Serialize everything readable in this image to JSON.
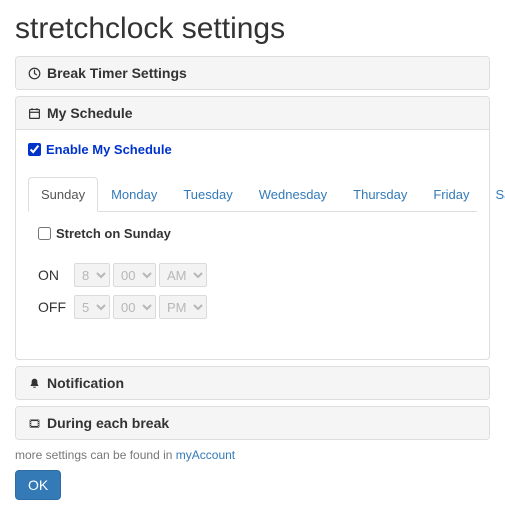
{
  "title": "stretchclock settings",
  "sections": {
    "breakTimer": "Break Timer Settings",
    "mySchedule": "My Schedule",
    "notification": "Notification",
    "duringBreak": "During each break"
  },
  "enable": {
    "label": "Enable My Schedule",
    "checked": true
  },
  "tabs": [
    "Sunday",
    "Monday",
    "Tuesday",
    "Wednesday",
    "Thursday",
    "Friday",
    "Saturday"
  ],
  "activeTab": 0,
  "stretchOn": {
    "label": "Stretch on Sunday",
    "checked": false
  },
  "time": {
    "onLabel": "ON",
    "offLabel": "OFF",
    "on": {
      "hour": "8",
      "minute": "00",
      "period": "AM"
    },
    "off": {
      "hour": "5",
      "minute": "00",
      "period": "PM"
    }
  },
  "footer": {
    "prefix": "more settings can be found in ",
    "link": "myAccount"
  },
  "okLabel": "OK"
}
